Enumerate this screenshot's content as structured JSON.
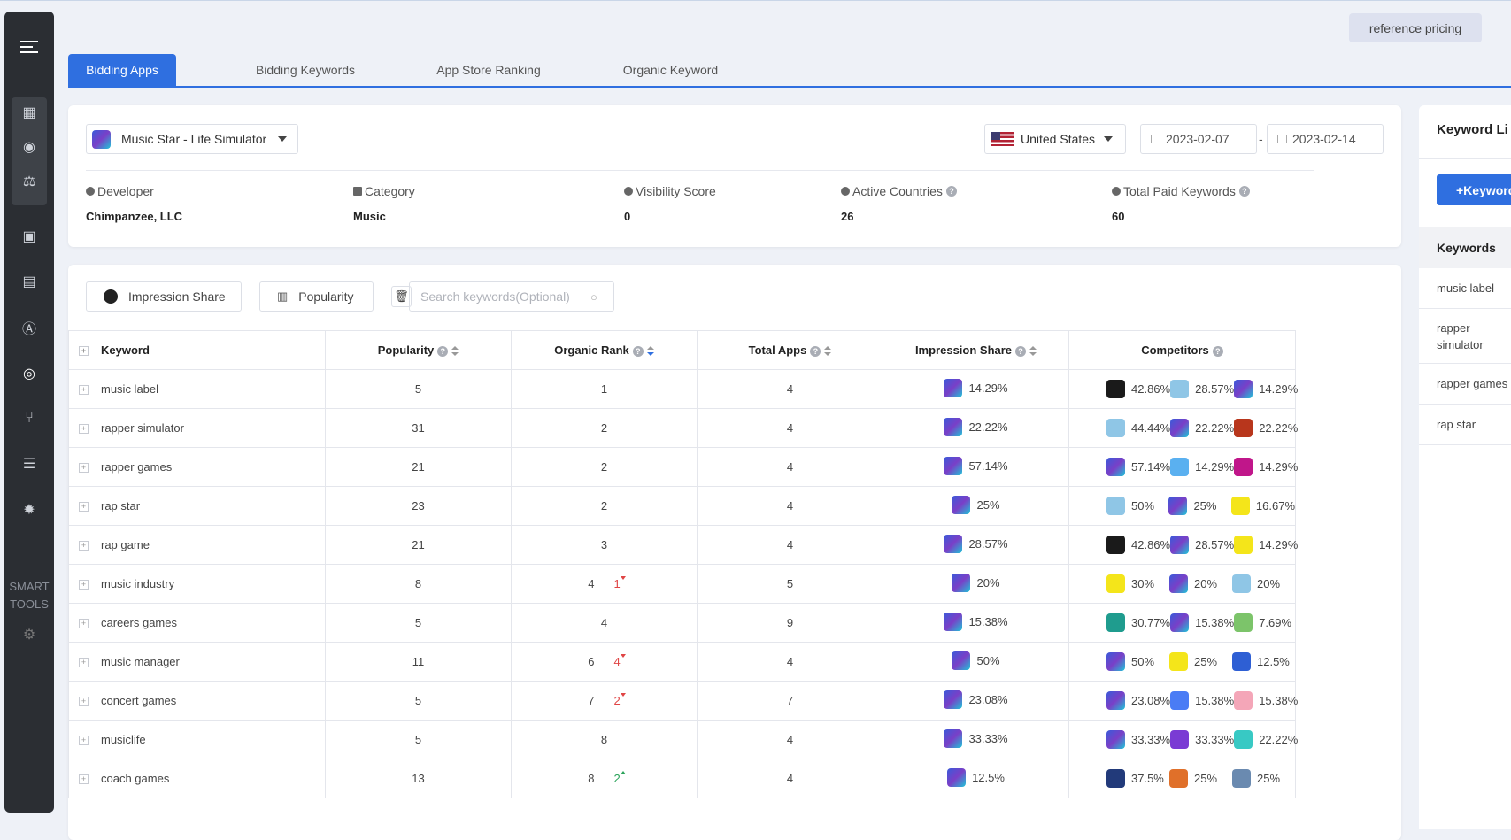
{
  "header": {
    "reference_pricing": "reference pricing"
  },
  "tabs": [
    {
      "label": "Bidding Apps",
      "active": true
    },
    {
      "label": "Bidding Keywords",
      "active": false
    },
    {
      "label": "App Store Ranking",
      "active": false
    },
    {
      "label": "Organic Keyword",
      "active": false
    }
  ],
  "filters": {
    "app": "Music Star - Life Simulator",
    "country": "United States",
    "date_start": "2023-02-07",
    "date_sep": "-",
    "date_end": "2023-02-14"
  },
  "meta": {
    "developer_label": "Developer",
    "developer": "Chimpanzee, LLC",
    "category_label": "Category",
    "category": "Music",
    "visibility_label": "Visibility Score",
    "visibility": "0",
    "countries_label": "Active Countries",
    "countries": "26",
    "paid_label": "Total Paid Keywords",
    "paid": "60"
  },
  "toolbar": {
    "impression_share": "Impression Share",
    "popularity": "Popularity",
    "search_placeholder": "Search keywords(Optional)"
  },
  "columns": {
    "keyword": "Keyword",
    "popularity": "Popularity",
    "organic_rank": "Organic Rank",
    "total_apps": "Total Apps",
    "impression_share": "Impression Share",
    "competitors": "Competitors"
  },
  "colors": {
    "music_star": "#4a4fc4",
    "gold_bars": "#1a1a1a",
    "hamster": "#8fc6e6",
    "red_flower": "#b8361c",
    "cyan_app": "#5ab0f0",
    "s_app": "#c0168a",
    "yellow_app": "#f4e51a",
    "teal_app": "#1f9c8e",
    "green_app": "#7cc46a",
    "drop_app": "#2e5fd4",
    "piano_app": "#4a7cf5",
    "anime_app": "#f4a6b8",
    "violet_app": "#7a3bd4",
    "amazon_app": "#38c9c4",
    "c_app": "#223a7a",
    "orange_app": "#e0702a",
    "steel_app": "#6a8ab0"
  },
  "rows": [
    {
      "keyword": "music label",
      "popularity": "5",
      "rank": "1",
      "rank_change": "",
      "rank_dir": "",
      "total_apps": "4",
      "share": "14.29%",
      "competitors": [
        {
          "v": "42.86%",
          "c": "gold_bars"
        },
        {
          "v": "28.57%",
          "c": "hamster"
        },
        {
          "v": "14.29%",
          "c": "music_star"
        }
      ]
    },
    {
      "keyword": "rapper simulator",
      "popularity": "31",
      "rank": "2",
      "rank_change": "",
      "rank_dir": "",
      "total_apps": "4",
      "share": "22.22%",
      "competitors": [
        {
          "v": "44.44%",
          "c": "hamster"
        },
        {
          "v": "22.22%",
          "c": "music_star"
        },
        {
          "v": "22.22%",
          "c": "red_flower"
        }
      ]
    },
    {
      "keyword": "rapper games",
      "popularity": "21",
      "rank": "2",
      "rank_change": "",
      "rank_dir": "",
      "total_apps": "4",
      "share": "57.14%",
      "competitors": [
        {
          "v": "57.14%",
          "c": "music_star"
        },
        {
          "v": "14.29%",
          "c": "cyan_app"
        },
        {
          "v": "14.29%",
          "c": "s_app"
        }
      ]
    },
    {
      "keyword": "rap star",
      "popularity": "23",
      "rank": "2",
      "rank_change": "",
      "rank_dir": "",
      "total_apps": "4",
      "share": "25%",
      "competitors": [
        {
          "v": "50%",
          "c": "hamster"
        },
        {
          "v": "25%",
          "c": "music_star"
        },
        {
          "v": "16.67%",
          "c": "yellow_app"
        }
      ]
    },
    {
      "keyword": "rap game",
      "popularity": "21",
      "rank": "3",
      "rank_change": "",
      "rank_dir": "",
      "total_apps": "4",
      "share": "28.57%",
      "competitors": [
        {
          "v": "42.86%",
          "c": "gold_bars"
        },
        {
          "v": "28.57%",
          "c": "music_star"
        },
        {
          "v": "14.29%",
          "c": "yellow_app"
        }
      ]
    },
    {
      "keyword": "music industry",
      "popularity": "8",
      "rank": "4",
      "rank_change": "1",
      "rank_dir": "down",
      "total_apps": "5",
      "share": "20%",
      "competitors": [
        {
          "v": "30%",
          "c": "yellow_app"
        },
        {
          "v": "20%",
          "c": "music_star"
        },
        {
          "v": "20%",
          "c": "hamster"
        }
      ]
    },
    {
      "keyword": "careers games",
      "popularity": "5",
      "rank": "4",
      "rank_change": "",
      "rank_dir": "",
      "total_apps": "9",
      "share": "15.38%",
      "competitors": [
        {
          "v": "30.77%",
          "c": "teal_app"
        },
        {
          "v": "15.38%",
          "c": "music_star"
        },
        {
          "v": "7.69%",
          "c": "green_app"
        }
      ]
    },
    {
      "keyword": "music manager",
      "popularity": "11",
      "rank": "6",
      "rank_change": "4",
      "rank_dir": "down",
      "total_apps": "4",
      "share": "50%",
      "competitors": [
        {
          "v": "50%",
          "c": "music_star"
        },
        {
          "v": "25%",
          "c": "yellow_app"
        },
        {
          "v": "12.5%",
          "c": "drop_app"
        }
      ]
    },
    {
      "keyword": "concert games",
      "popularity": "5",
      "rank": "7",
      "rank_change": "2",
      "rank_dir": "down",
      "total_apps": "7",
      "share": "23.08%",
      "competitors": [
        {
          "v": "23.08%",
          "c": "music_star"
        },
        {
          "v": "15.38%",
          "c": "piano_app"
        },
        {
          "v": "15.38%",
          "c": "anime_app"
        }
      ]
    },
    {
      "keyword": "musiclife",
      "popularity": "5",
      "rank": "8",
      "rank_change": "",
      "rank_dir": "",
      "total_apps": "4",
      "share": "33.33%",
      "competitors": [
        {
          "v": "33.33%",
          "c": "music_star"
        },
        {
          "v": "33.33%",
          "c": "violet_app"
        },
        {
          "v": "22.22%",
          "c": "amazon_app"
        }
      ]
    },
    {
      "keyword": "coach games",
      "popularity": "13",
      "rank": "8",
      "rank_change": "2",
      "rank_dir": "up",
      "total_apps": "4",
      "share": "12.5%",
      "competitors": [
        {
          "v": "37.5%",
          "c": "c_app"
        },
        {
          "v": "25%",
          "c": "orange_app"
        },
        {
          "v": "25%",
          "c": "steel_app"
        }
      ]
    }
  ],
  "right_panel": {
    "title": "Keyword Li",
    "add_button": "+Keyword",
    "header": "Keywords",
    "items": [
      "music label",
      "rapper simulator",
      "rapper games",
      "rap star"
    ]
  },
  "sidebar": {
    "smart_tools": "SMART TOOLS"
  }
}
